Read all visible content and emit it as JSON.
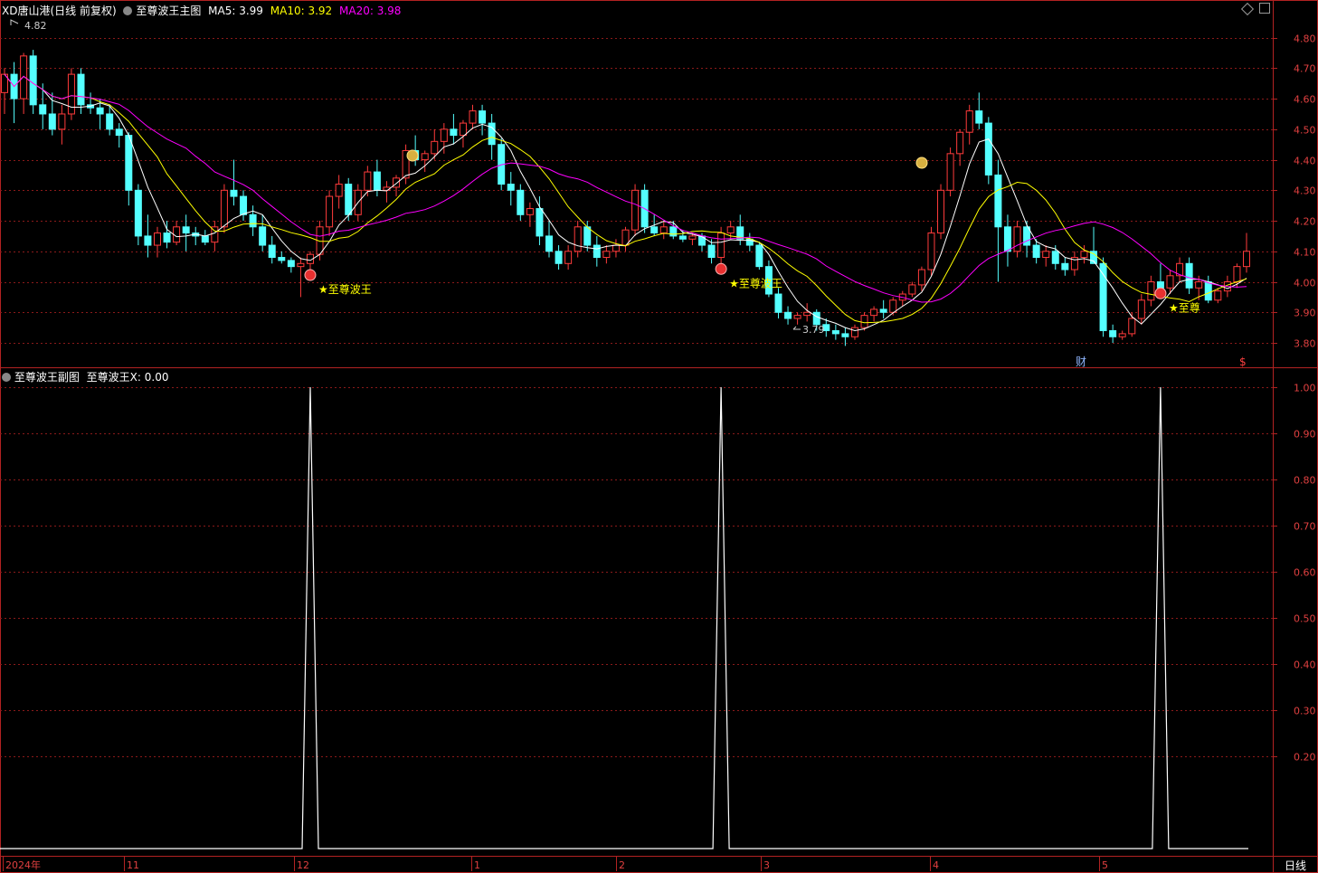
{
  "main_header": {
    "stock_name": "XD唐山港",
    "period": "(日线 前复权)",
    "indicator": "至尊波王主图",
    "ma5_label": "MA5: 3.99",
    "ma10_label": "MA10: 3.92",
    "ma20_label": "MA20: 3.98"
  },
  "sub_header": {
    "indicator": "至尊波王副图",
    "value_label": "至尊波王X: 0.00"
  },
  "annotations": {
    "high_label": "4.82",
    "low_label": "3.79",
    "signal_label": "★至尊波王",
    "signal_label_clipped": "★至尊",
    "finance_marker": "财",
    "dollar_marker": "$"
  },
  "colors": {
    "up": "#ff3b3b",
    "down": "#54ffff",
    "ma5": "#ffffff",
    "ma10": "#ffff00",
    "ma20": "#ff00ff",
    "grid": "#8b1a1a",
    "border": "#b22222"
  },
  "price_axis": [
    "4.80",
    "4.70",
    "4.60",
    "4.50",
    "4.40",
    "4.30",
    "4.20",
    "4.10",
    "4.00",
    "3.90",
    "3.80"
  ],
  "sub_axis": [
    "1.00",
    "0.90",
    "0.80",
    "0.70",
    "0.60",
    "0.50",
    "0.40",
    "0.30",
    "0.20"
  ],
  "date_axis": [
    "2024年",
    "11",
    "12",
    "1",
    "2",
    "3",
    "4",
    "5"
  ],
  "period_label": "日线",
  "chart_data": {
    "type": "candlestick",
    "main_ylim": [
      3.72,
      4.87
    ],
    "sub_ylim": [
      0,
      1.0
    ],
    "candles": [
      [
        4.62,
        4.7,
        4.55,
        4.68
      ],
      [
        4.68,
        4.72,
        4.52,
        4.6
      ],
      [
        4.6,
        4.75,
        4.55,
        4.74
      ],
      [
        4.74,
        4.76,
        4.55,
        4.58
      ],
      [
        4.58,
        4.65,
        4.5,
        4.55
      ],
      [
        4.55,
        4.62,
        4.48,
        4.5
      ],
      [
        4.5,
        4.58,
        4.45,
        4.55
      ],
      [
        4.55,
        4.7,
        4.53,
        4.68
      ],
      [
        4.68,
        4.7,
        4.55,
        4.58
      ],
      [
        4.58,
        4.62,
        4.55,
        4.57
      ],
      [
        4.57,
        4.6,
        4.5,
        4.55
      ],
      [
        4.55,
        4.58,
        4.48,
        4.5
      ],
      [
        4.5,
        4.52,
        4.44,
        4.48
      ],
      [
        4.48,
        4.49,
        4.25,
        4.3
      ],
      [
        4.3,
        4.32,
        4.12,
        4.15
      ],
      [
        4.15,
        4.22,
        4.08,
        4.12
      ],
      [
        4.12,
        4.18,
        4.08,
        4.16
      ],
      [
        4.16,
        4.2,
        4.11,
        4.13
      ],
      [
        4.13,
        4.2,
        4.12,
        4.18
      ],
      [
        4.18,
        4.22,
        4.1,
        4.16
      ],
      [
        4.16,
        4.18,
        4.12,
        4.15
      ],
      [
        4.15,
        4.17,
        4.12,
        4.13
      ],
      [
        4.13,
        4.2,
        4.1,
        4.18
      ],
      [
        4.18,
        4.32,
        4.16,
        4.3
      ],
      [
        4.3,
        4.4,
        4.25,
        4.28
      ],
      [
        4.28,
        4.3,
        4.2,
        4.22
      ],
      [
        4.22,
        4.25,
        4.15,
        4.18
      ],
      [
        4.18,
        4.22,
        4.1,
        4.12
      ],
      [
        4.12,
        4.15,
        4.06,
        4.08
      ],
      [
        4.08,
        4.1,
        4.06,
        4.07
      ],
      [
        4.07,
        4.08,
        4.03,
        4.05
      ],
      [
        4.05,
        4.08,
        3.95,
        4.06
      ],
      [
        4.06,
        4.1,
        4.04,
        4.09
      ],
      [
        4.09,
        4.2,
        4.07,
        4.18
      ],
      [
        4.18,
        4.3,
        4.15,
        4.28
      ],
      [
        4.28,
        4.35,
        4.24,
        4.32
      ],
      [
        4.32,
        4.34,
        4.2,
        4.22
      ],
      [
        4.22,
        4.32,
        4.2,
        4.3
      ],
      [
        4.3,
        4.38,
        4.28,
        4.36
      ],
      [
        4.36,
        4.4,
        4.28,
        4.3
      ],
      [
        4.3,
        4.33,
        4.26,
        4.31
      ],
      [
        4.31,
        4.35,
        4.28,
        4.34
      ],
      [
        4.34,
        4.45,
        4.32,
        4.43
      ],
      [
        4.43,
        4.48,
        4.38,
        4.4
      ],
      [
        4.4,
        4.43,
        4.36,
        4.42
      ],
      [
        4.42,
        4.5,
        4.4,
        4.46
      ],
      [
        4.46,
        4.52,
        4.42,
        4.5
      ],
      [
        4.5,
        4.55,
        4.45,
        4.48
      ],
      [
        4.48,
        4.53,
        4.44,
        4.52
      ],
      [
        4.52,
        4.58,
        4.5,
        4.56
      ],
      [
        4.56,
        4.58,
        4.48,
        4.52
      ],
      [
        4.52,
        4.55,
        4.4,
        4.45
      ],
      [
        4.45,
        4.47,
        4.3,
        4.32
      ],
      [
        4.32,
        4.36,
        4.25,
        4.3
      ],
      [
        4.3,
        4.32,
        4.2,
        4.22
      ],
      [
        4.22,
        4.26,
        4.18,
        4.24
      ],
      [
        4.24,
        4.28,
        4.12,
        4.15
      ],
      [
        4.15,
        4.2,
        4.08,
        4.1
      ],
      [
        4.1,
        4.12,
        4.04,
        4.06
      ],
      [
        4.06,
        4.12,
        4.04,
        4.1
      ],
      [
        4.1,
        4.2,
        4.08,
        4.18
      ],
      [
        4.18,
        4.2,
        4.1,
        4.12
      ],
      [
        4.12,
        4.15,
        4.05,
        4.08
      ],
      [
        4.08,
        4.12,
        4.06,
        4.1
      ],
      [
        4.1,
        4.14,
        4.08,
        4.12
      ],
      [
        4.12,
        4.18,
        4.1,
        4.17
      ],
      [
        4.17,
        4.32,
        4.15,
        4.3
      ],
      [
        4.3,
        4.32,
        4.16,
        4.18
      ],
      [
        4.18,
        4.22,
        4.15,
        4.16
      ],
      [
        4.16,
        4.2,
        4.14,
        4.18
      ],
      [
        4.18,
        4.2,
        4.14,
        4.15
      ],
      [
        4.15,
        4.17,
        4.13,
        4.14
      ],
      [
        4.14,
        4.16,
        4.12,
        4.15
      ],
      [
        4.15,
        4.16,
        4.1,
        4.12
      ],
      [
        4.12,
        4.14,
        4.06,
        4.08
      ],
      [
        4.08,
        4.18,
        4.06,
        4.16
      ],
      [
        4.16,
        4.2,
        4.14,
        4.18
      ],
      [
        4.18,
        4.22,
        4.12,
        4.14
      ],
      [
        4.14,
        4.16,
        4.1,
        4.12
      ],
      [
        4.12,
        4.13,
        4.04,
        4.05
      ],
      [
        4.05,
        4.07,
        3.95,
        3.96
      ],
      [
        3.96,
        3.98,
        3.88,
        3.9
      ],
      [
        3.9,
        3.92,
        3.86,
        3.88
      ],
      [
        3.88,
        3.9,
        3.86,
        3.89
      ],
      [
        3.89,
        3.93,
        3.87,
        3.9
      ],
      [
        3.9,
        3.91,
        3.84,
        3.86
      ],
      [
        3.86,
        3.88,
        3.82,
        3.84
      ],
      [
        3.84,
        3.86,
        3.81,
        3.83
      ],
      [
        3.83,
        3.85,
        3.79,
        3.82
      ],
      [
        3.82,
        3.86,
        3.81,
        3.85
      ],
      [
        3.85,
        3.9,
        3.84,
        3.89
      ],
      [
        3.89,
        3.92,
        3.87,
        3.91
      ],
      [
        3.91,
        3.94,
        3.88,
        3.9
      ],
      [
        3.9,
        3.95,
        3.89,
        3.94
      ],
      [
        3.94,
        3.97,
        3.92,
        3.96
      ],
      [
        3.96,
        4.0,
        3.95,
        3.99
      ],
      [
        3.99,
        4.05,
        3.97,
        4.04
      ],
      [
        4.04,
        4.18,
        4.02,
        4.16
      ],
      [
        4.16,
        4.32,
        4.14,
        4.3
      ],
      [
        4.3,
        4.44,
        4.28,
        4.42
      ],
      [
        4.42,
        4.5,
        4.38,
        4.49
      ],
      [
        4.49,
        4.58,
        4.45,
        4.56
      ],
      [
        4.56,
        4.62,
        4.5,
        4.52
      ],
      [
        4.52,
        4.54,
        4.32,
        4.35
      ],
      [
        4.35,
        4.4,
        4.0,
        4.18
      ],
      [
        4.18,
        4.22,
        4.05,
        4.1
      ],
      [
        4.1,
        4.2,
        4.08,
        4.18
      ],
      [
        4.18,
        4.2,
        4.08,
        4.12
      ],
      [
        4.12,
        4.14,
        4.06,
        4.08
      ],
      [
        4.08,
        4.12,
        4.05,
        4.1
      ],
      [
        4.1,
        4.12,
        4.04,
        4.06
      ],
      [
        4.06,
        4.08,
        4.02,
        4.04
      ],
      [
        4.04,
        4.1,
        4.02,
        4.08
      ],
      [
        4.08,
        4.12,
        4.06,
        4.1
      ],
      [
        4.1,
        4.18,
        4.08,
        4.06
      ],
      [
        4.06,
        4.08,
        3.82,
        3.84
      ],
      [
        3.84,
        3.86,
        3.8,
        3.82
      ],
      [
        3.82,
        3.84,
        3.81,
        3.83
      ],
      [
        3.83,
        3.9,
        3.82,
        3.88
      ],
      [
        3.88,
        3.96,
        3.86,
        3.94
      ],
      [
        3.94,
        4.02,
        3.92,
        4.0
      ],
      [
        4.0,
        4.06,
        3.98,
        3.98
      ],
      [
        3.98,
        4.04,
        3.96,
        4.02
      ],
      [
        4.02,
        4.08,
        4.0,
        4.06
      ],
      [
        4.06,
        4.08,
        3.96,
        3.98
      ],
      [
        3.98,
        4.02,
        3.94,
        4.0
      ],
      [
        4.0,
        4.02,
        3.93,
        3.94
      ],
      [
        3.94,
        3.98,
        3.93,
        3.97
      ],
      [
        3.97,
        4.02,
        3.95,
        4.0
      ],
      [
        4.0,
        4.06,
        3.98,
        4.05
      ],
      [
        4.05,
        4.16,
        4.03,
        4.1
      ]
    ],
    "signal_indices": [
      32,
      75,
      121
    ],
    "sub_series_peaks": [
      32,
      75,
      121
    ]
  }
}
